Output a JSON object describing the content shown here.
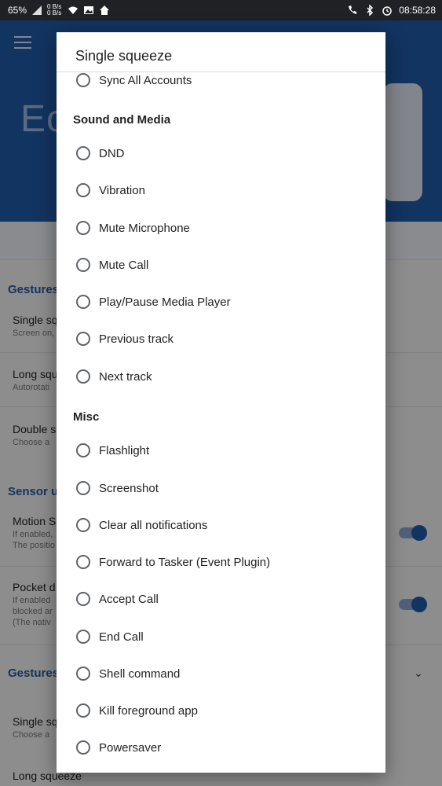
{
  "status_bar": {
    "battery": "65%",
    "net_up": "0 B/s",
    "net_down": "0 B/s",
    "time": "08:58:28"
  },
  "background": {
    "title_fragment": "Ec",
    "sections": [
      {
        "label": "Gestures",
        "items": [
          {
            "title": "Single sq",
            "subtitle": "Screen on,"
          },
          {
            "title": "Long squ",
            "subtitle": "Autorotati"
          },
          {
            "title": "Double s",
            "subtitle": "Choose a"
          }
        ]
      },
      {
        "label": "Sensor u",
        "items": [
          {
            "title": "Motion S",
            "subtitle": "If enabled,",
            "subtitle2": "The positio"
          },
          {
            "title": "Pocket d",
            "subtitle": "If enabled",
            "subtitle2": "blocked ar",
            "subtitle3": "(The nativ"
          }
        ]
      },
      {
        "label": "Gestures",
        "items": [
          {
            "title": "Single sq",
            "subtitle": "Choose a"
          },
          {
            "title": "Long squeeze",
            "subtitle": ""
          }
        ]
      }
    ]
  },
  "dialog": {
    "title": "Single squeeze",
    "partial_item": "Sync All Accounts",
    "categories": [
      {
        "label": "Sound and Media",
        "options": [
          "DND",
          "Vibration",
          "Mute Microphone",
          "Mute Call",
          "Play/Pause Media Player",
          "Previous track",
          "Next track"
        ]
      },
      {
        "label": "Misc",
        "options": [
          "Flashlight",
          "Screenshot",
          "Clear all notifications",
          "Forward to Tasker (Event Plugin)",
          "Accept Call",
          "End Call",
          "Shell command",
          "Kill foreground app",
          "Powersaver"
        ]
      }
    ]
  },
  "colors": {
    "accent": "#1f5aa6",
    "radio": "#5f6368"
  }
}
